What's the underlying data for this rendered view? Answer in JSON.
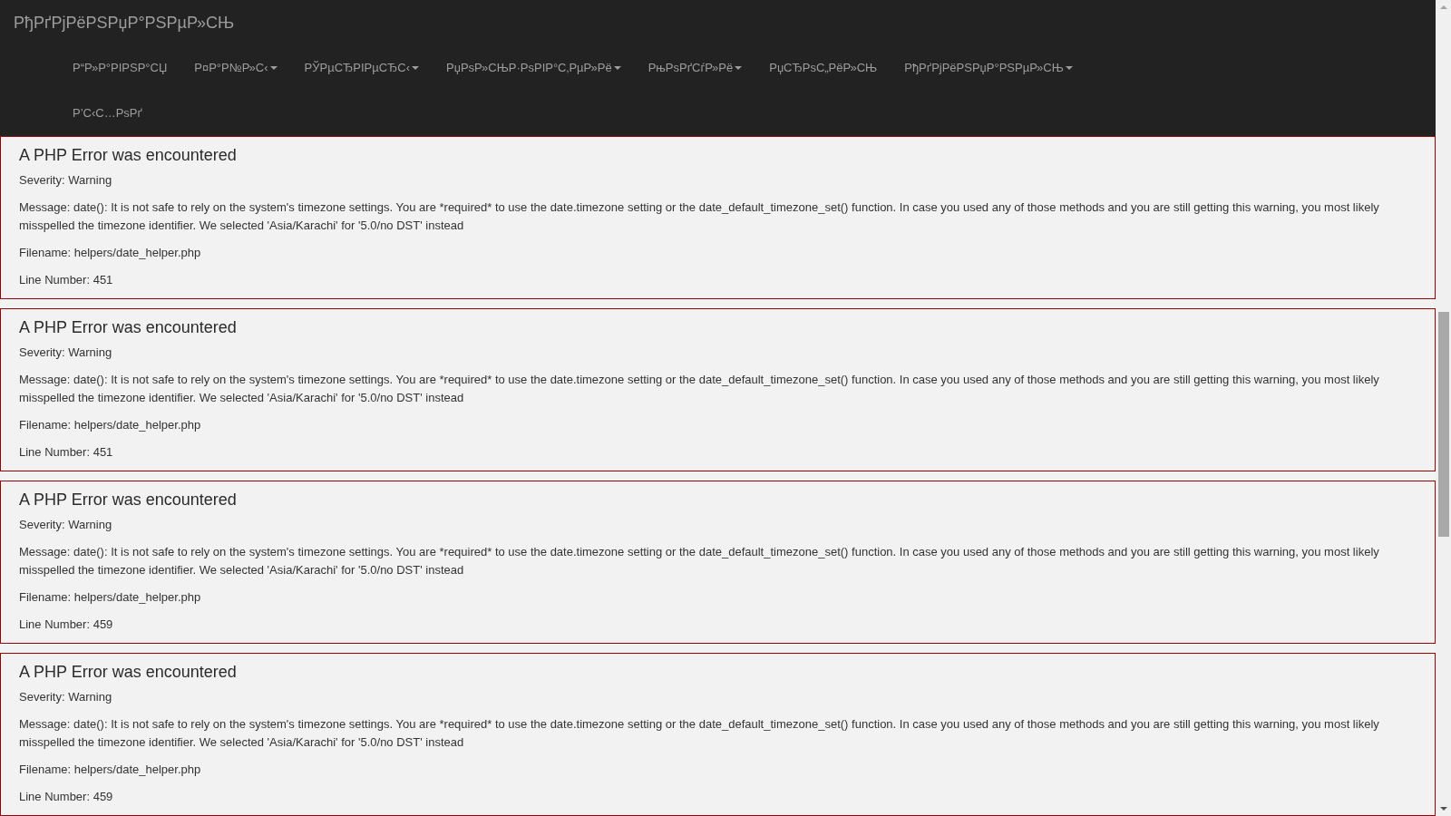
{
  "navbar": {
    "brand": "РђРґРјРёРЅРџР°РЅРµР»СЊ",
    "items": [
      {
        "label": "Р“Р»Р°РІРЅР°СЏ",
        "kind": "link"
      },
      {
        "label": "Р¤Р°Р№Р»С‹",
        "kind": "dropdown"
      },
      {
        "label": "РЎРµСЂРІРµСЂС‹",
        "kind": "dropdown"
      },
      {
        "label": "РџРѕР»СЊР·РѕРІР°С‚РµР»Рё",
        "kind": "dropdown"
      },
      {
        "label": "РњРѕРґСѓР»Рё",
        "kind": "dropdown"
      },
      {
        "label": "РџСЂРѕС„РёР»СЊ",
        "kind": "link"
      },
      {
        "label": "РђРґРјРёРЅРџР°РЅРµР»СЊ",
        "kind": "dropdown"
      },
      {
        "label": "Р’С‹С…РѕРґ",
        "kind": "link"
      }
    ]
  },
  "errors": [
    {
      "heading": "A PHP Error was encountered",
      "severity": "Severity: Warning",
      "message": "Message: date(): It is not safe to rely on the system's timezone settings. You are *required* to use the date.timezone setting or the date_default_timezone_set() function. In case you used any of those methods and you are still getting this warning, you most likely misspelled the timezone identifier. We selected 'Asia/Karachi' for '5.0/no DST' instead",
      "filename": "Filename: helpers/date_helper.php",
      "line_number": "Line Number: 451"
    },
    {
      "heading": "A PHP Error was encountered",
      "severity": "Severity: Warning",
      "message": "Message: date(): It is not safe to rely on the system's timezone settings. You are *required* to use the date.timezone setting or the date_default_timezone_set() function. In case you used any of those methods and you are still getting this warning, you most likely misspelled the timezone identifier. We selected 'Asia/Karachi' for '5.0/no DST' instead",
      "filename": "Filename: helpers/date_helper.php",
      "line_number": "Line Number: 451"
    },
    {
      "heading": "A PHP Error was encountered",
      "severity": "Severity: Warning",
      "message": "Message: date(): It is not safe to rely on the system's timezone settings. You are *required* to use the date.timezone setting or the date_default_timezone_set() function. In case you used any of those methods and you are still getting this warning, you most likely misspelled the timezone identifier. We selected 'Asia/Karachi' for '5.0/no DST' instead",
      "filename": "Filename: helpers/date_helper.php",
      "line_number": "Line Number: 459"
    },
    {
      "heading": "A PHP Error was encountered",
      "severity": "Severity: Warning",
      "message": "Message: date(): It is not safe to rely on the system's timezone settings. You are *required* to use the date.timezone setting or the date_default_timezone_set() function. In case you used any of those methods and you are still getting this warning, you most likely misspelled the timezone identifier. We selected 'Asia/Karachi' for '5.0/no DST' instead",
      "filename": "Filename: helpers/date_helper.php",
      "line_number": "Line Number: 459"
    }
  ]
}
